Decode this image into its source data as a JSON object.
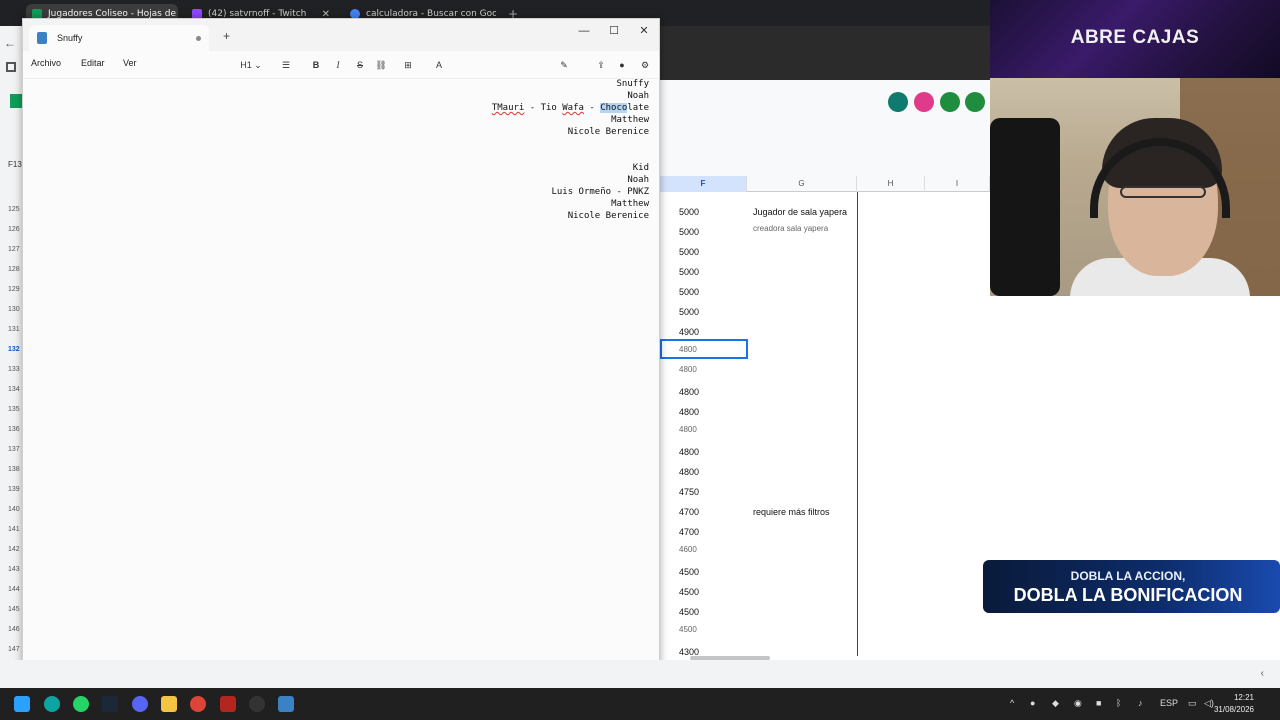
{
  "browser": {
    "tabs": [
      {
        "label": "Jugadores Coliseo - Hojas de c",
        "active": true,
        "favicon_color": "#0f9d58"
      },
      {
        "label": "(42) satvrnoff - Twitch",
        "active": false,
        "favicon_color": "#9146ff"
      },
      {
        "label": "calculadora - Buscar con Goog",
        "active": false,
        "favicon_color": "#4285f4"
      }
    ],
    "new_tab": "+"
  },
  "notepad": {
    "tab_title": "Snuffy",
    "menu": [
      "Archivo",
      "Editar",
      "Ver"
    ],
    "heading_dropdown": "H1",
    "toolbar_icons": [
      "list-icon",
      "bold-icon",
      "italic-icon",
      "strikethrough-icon",
      "link-icon",
      "table-icon",
      "clear-format-icon",
      "copilot-icon",
      "share-icon",
      "account-icon",
      "settings-icon"
    ],
    "lines_group1": [
      "Snuffy",
      "Noah",
      "TMauri - Tio Wafa - Chocolate",
      "Matthew",
      "Nicole Berenice"
    ],
    "line3_parts": {
      "a": "TMauri",
      "b": " - Tio ",
      "c": "Wafa",
      "d": " - ",
      "e": "Choco",
      "f": "late"
    },
    "lines_group2": [
      "Kid",
      "Noah",
      "Luis Ormeño - PNKZ",
      "Matthew",
      "Nicole Berenice"
    ]
  },
  "sheet": {
    "name_box": "F13",
    "columns": [
      "F",
      "G",
      "H",
      "I"
    ],
    "selected_column": "F",
    "row_numbers": [
      "125",
      "126",
      "127",
      "128",
      "129",
      "130",
      "131",
      "132",
      "133",
      "134",
      "135",
      "136",
      "137",
      "138",
      "139",
      "140",
      "141",
      "142",
      "143",
      "144",
      "145",
      "146",
      "147"
    ],
    "selected_row": "132",
    "f_values": [
      "5000",
      "5000",
      "5000",
      "5000",
      "5000",
      "5000",
      "4900",
      "4800",
      "4800",
      "4800",
      "4800",
      "4800",
      "4800",
      "4800",
      "4750",
      "4700",
      "4700",
      "4600",
      "4500",
      "4500",
      "4500",
      "4500",
      "4300"
    ],
    "g_notes": {
      "0": "Jugador de sala yapera",
      "1": "creadora sala yapera",
      "15": "requiere más filtros"
    }
  },
  "stream_overlay": {
    "banner": "ABRE CAJAS",
    "promo_line1": "DOBLA LA ACCION,",
    "promo_line2": "DOBLA LA BONIFICACION"
  },
  "taskbar": {
    "language": "ESP",
    "time": "12:21",
    "date": "31/08/2026"
  }
}
